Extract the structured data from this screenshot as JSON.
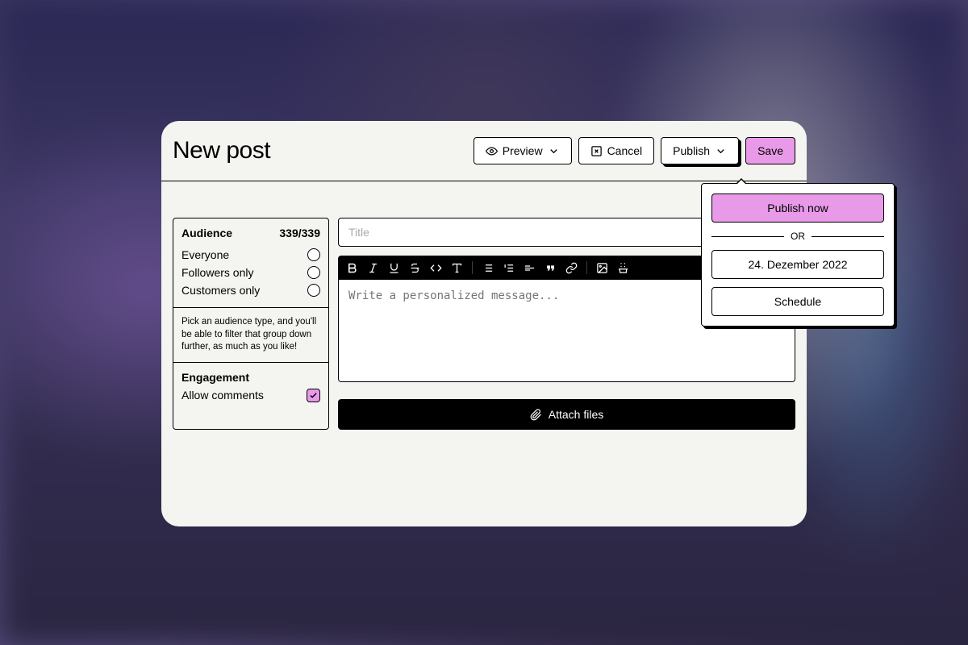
{
  "header": {
    "title": "New post",
    "preview": "Preview",
    "cancel": "Cancel",
    "publish": "Publish",
    "save": "Save"
  },
  "sidebar": {
    "audience_title": "Audience",
    "audience_count": "339/339",
    "options": {
      "everyone": "Everyone",
      "followers": "Followers only",
      "customers": "Customers only"
    },
    "hint": "Pick an audience type, and you'll be able to filter that group down further, as much as you like!",
    "engagement_title": "Engagement",
    "allow_comments": "Allow comments"
  },
  "editor": {
    "title_placeholder": "Title",
    "body_placeholder": "Write a personalized message...",
    "attach": "Attach files"
  },
  "dropdown": {
    "publish_now": "Publish now",
    "or": "OR",
    "date": "24. Dezember 2022",
    "schedule": "Schedule"
  }
}
